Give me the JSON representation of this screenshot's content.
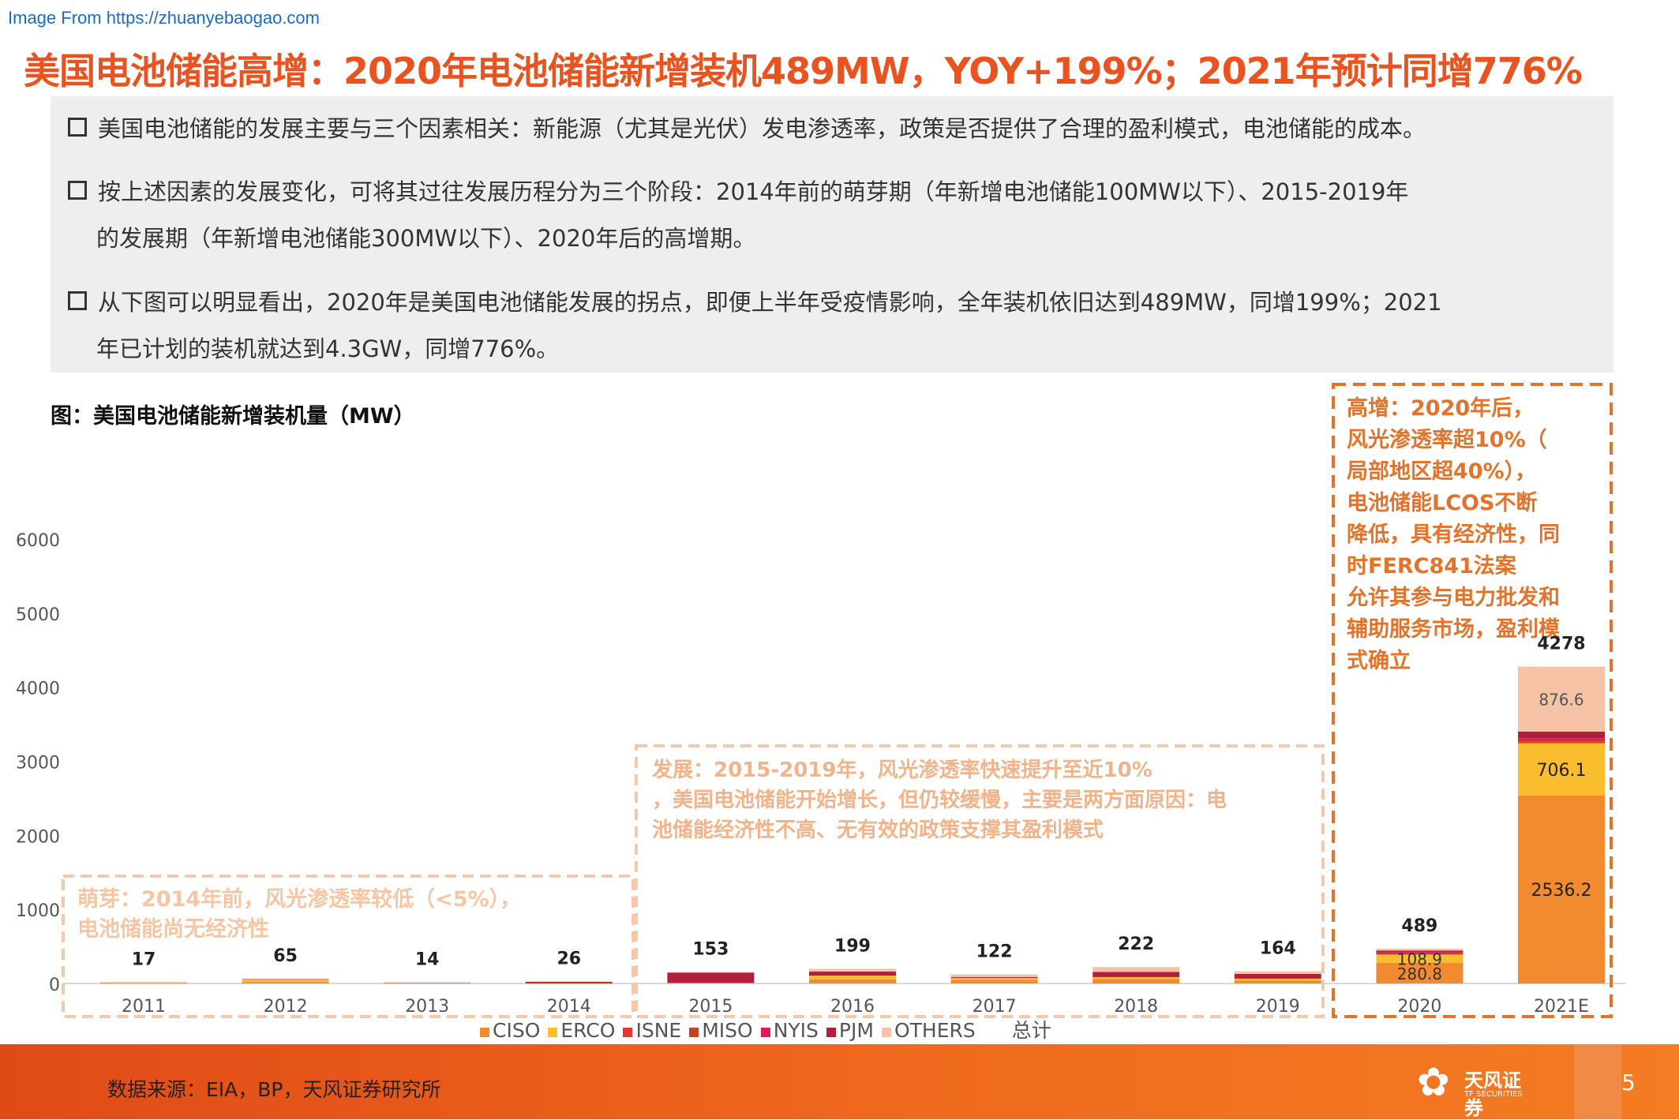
{
  "watermark": "Image From https://zhuanyebaogao.com",
  "title": "美国电池储能高增：2020年电池储能新增装机489MW，YOY+199%；2021年预计同增776%",
  "bullets": [
    {
      "line1": "美国电池储能的发展主要与三个因素相关：新能源（尤其是光伏）发电渗透率，政策是否提供了合理的盈利模式，电池储能的成本。",
      "line2": ""
    },
    {
      "line1": "按上述因素的发展变化，可将其过往发展历程分为三个阶段：2014年前的萌芽期（年新增电池储能100MW以下）、2015-2019年",
      "line2": "的发展期（年新增电池储能300MW以下）、2020年后的高增期。"
    },
    {
      "line1": "从下图可以明显看出，2020年是美国电池储能发展的拐点，即便上半年受疫情影响，全年装机依旧达到489MW，同增199%；2021",
      "line2": "年已计划的装机就达到4.3GW，同增776%。"
    }
  ],
  "chart_title": "图：美国电池储能新增装机量（MW）",
  "annotations": {
    "budding": "萌芽：2014年前，风光渗透率较低（<5%），电池储能尚无经济性",
    "development": "发展：2015-2019年，风光渗透率快速提升至近10%，美国电池储能开始增长，但仍较缓慢，主要是两方面原因：电池储能经济性不高、无有效的政策支撑其盈利模式",
    "high_growth": "高增：2020年后，风光渗透率超10%（局部地区超40%），电池储能LCOS不断降低，具有经济性，同时FERC841法案允许其参与电力批发和辅助服务市场，盈利模式确立"
  },
  "chart_data": {
    "type": "bar",
    "stacked": true,
    "categories": [
      "2011",
      "2012",
      "2013",
      "2014",
      "2015",
      "2016",
      "2017",
      "2018",
      "2019",
      "2020",
      "2021E"
    ],
    "ylim": [
      0,
      6000
    ],
    "yticks": [
      0,
      1000,
      2000,
      3000,
      4000,
      5000,
      6000
    ],
    "totals": [
      17,
      65,
      14,
      26,
      153,
      199,
      122,
      222,
      164,
      489,
      4278
    ],
    "series": [
      {
        "name": "CISO",
        "color": "#f28a30",
        "values": [
          3,
          20,
          4,
          2,
          5,
          55,
          50,
          60,
          40,
          280.8,
          2536.2
        ]
      },
      {
        "name": "ERCO",
        "color": "#f9bd2e",
        "values": [
          8,
          35,
          4,
          2,
          2,
          50,
          25,
          25,
          25,
          108.9,
          706.1
        ]
      },
      {
        "name": "ISNE",
        "color": "#e8342a",
        "values": [
          0,
          0,
          0,
          0,
          0,
          0,
          0,
          0,
          0,
          0,
          20
        ]
      },
      {
        "name": "MISO",
        "color": "#c4441f",
        "values": [
          0,
          0,
          0,
          2,
          0,
          0,
          0,
          5,
          0,
          15,
          20
        ]
      },
      {
        "name": "NYIS",
        "color": "#e0195a",
        "values": [
          0,
          0,
          0,
          0,
          0,
          0,
          0,
          0,
          0,
          20,
          30
        ]
      },
      {
        "name": "PJM",
        "color": "#b01f3c",
        "values": [
          4,
          5,
          4,
          18,
          140,
          55,
          12,
          65,
          65,
          20,
          89
        ]
      },
      {
        "name": "OTHERS",
        "color": "#f7c3a7",
        "values": [
          2,
          5,
          2,
          2,
          6,
          39,
          35,
          67,
          34,
          24.3,
          876.6
        ]
      }
    ],
    "data_labels": {
      "2020": [
        "280.8",
        "108.9"
      ],
      "2021E": [
        "2536.2",
        "706.1",
        "876.6"
      ]
    },
    "legend_extra": "总计"
  },
  "footer": {
    "source": "数据来源：EIA，BP，天风证券研究所",
    "logo_cn": "天风证券",
    "logo_en": "TF SECURITIES",
    "page": "5"
  },
  "colors": {
    "accent": "#e8531f",
    "dash": "#e3732a",
    "dash_light": "#f6c8a8",
    "footer": "#e9571b"
  }
}
